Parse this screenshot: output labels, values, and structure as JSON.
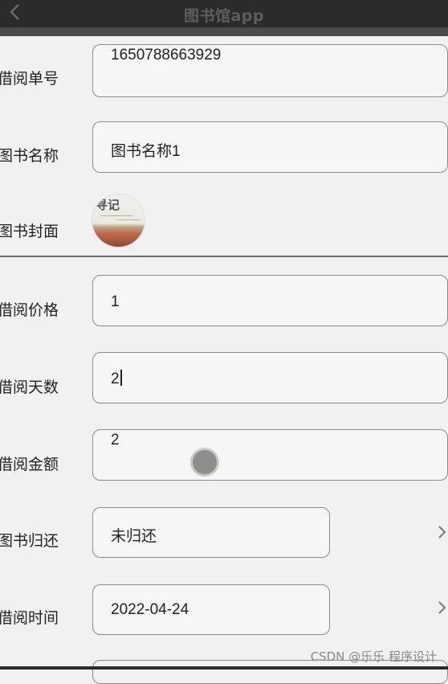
{
  "app": {
    "title": "图书馆app",
    "back_icon": "chevron-left-icon"
  },
  "form": {
    "borrow_no": {
      "label": "借阅单号",
      "value": "1650788663929"
    },
    "book_name": {
      "label": "图书名称",
      "value": "图书名称1"
    },
    "book_cover": {
      "label": "图书封面",
      "cover_text": "寻记"
    },
    "borrow_price": {
      "label": "借阅价格",
      "value": "1"
    },
    "borrow_days": {
      "label": "借阅天数",
      "value": "2"
    },
    "borrow_amount": {
      "label": "借阅金额",
      "value": "2"
    },
    "return_status": {
      "label": "图书归还",
      "value": "未归还",
      "icon": "chevron-right-icon"
    },
    "borrow_time": {
      "label": "借阅时间",
      "value": "2022-04-24",
      "icon": "chevron-right-icon"
    }
  },
  "watermark": "CSDN @乐乐 程序设计",
  "colors": {
    "topbar": "#2b2b2b",
    "background": "#f1f1f1",
    "field_border": "#8c8c8c"
  }
}
